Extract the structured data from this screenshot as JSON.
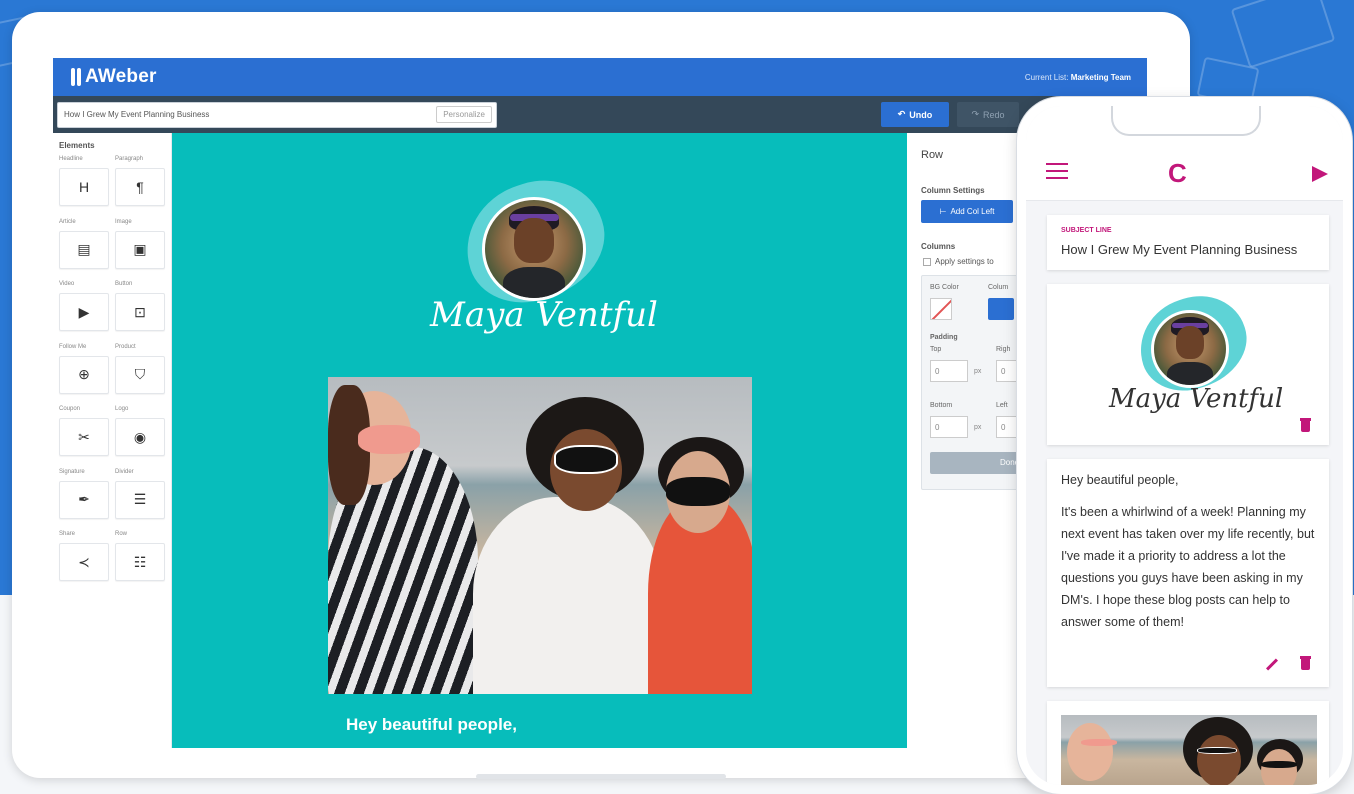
{
  "brand": {
    "name": "AWeber"
  },
  "header": {
    "current_list_label": "Current List:",
    "current_list_value": "Marketing Team"
  },
  "toolbar": {
    "subject": "How I Grew My Event Planning Business",
    "personalize": "Personalize",
    "undo_label": "Undo",
    "redo_label": "Redo"
  },
  "sidebar": {
    "title": "Elements",
    "items": [
      {
        "label": "Headline",
        "glyph": "H"
      },
      {
        "label": "Paragraph",
        "glyph": "¶"
      },
      {
        "label": "Article",
        "glyph": "▤"
      },
      {
        "label": "Image",
        "glyph": "▣"
      },
      {
        "label": "Video",
        "glyph": "▶"
      },
      {
        "label": "Button",
        "glyph": "⊡"
      },
      {
        "label": "Follow Me",
        "glyph": "⊕"
      },
      {
        "label": "Product",
        "glyph": "⛉"
      },
      {
        "label": "Coupon",
        "glyph": "✂"
      },
      {
        "label": "Logo",
        "glyph": "◉"
      },
      {
        "label": "Signature",
        "glyph": "✒"
      },
      {
        "label": "Divider",
        "glyph": "☰"
      },
      {
        "label": "Share",
        "glyph": "≺"
      },
      {
        "label": "Row",
        "glyph": "☷"
      }
    ]
  },
  "canvas": {
    "signature": "Maya Ventful",
    "heading": "Hey beautiful people,"
  },
  "settings": {
    "title": "Row",
    "column_settings": "Column Settings",
    "add_col_left": "Add Col Left",
    "columns": "Columns",
    "apply": "Apply settings to",
    "bg_color": "BG Color",
    "column_label": "Colum",
    "padding": "Padding",
    "top": "Top",
    "right": "Righ",
    "bottom": "Bottom",
    "left": "Left",
    "top_value": "0",
    "right_value": "0",
    "bottom_value": "0",
    "left_value": "0",
    "unit": "px",
    "done": "Done"
  },
  "phone": {
    "subject_label": "SUBJECT LINE",
    "subject": "How I Grew My Event Planning Business",
    "signature": "Maya Ventful",
    "greeting": "Hey beautiful people,",
    "body": "It's been a whirlwind of a week! Planning my next event has taken over my life recently, but I've made it a priority to address a lot the questions you guys have been asking in my DM's. I hope these blog posts can help to answer some of them!"
  },
  "colors": {
    "brand_blue": "#2b6fd2",
    "canvas_teal": "#07bdbb",
    "phone_accent": "#c2177a",
    "toolbar_dark": "#344859"
  },
  "icons": [
    "menu-icon",
    "send-icon",
    "trash-icon",
    "pencil-icon",
    "undo-icon",
    "redo-icon"
  ]
}
